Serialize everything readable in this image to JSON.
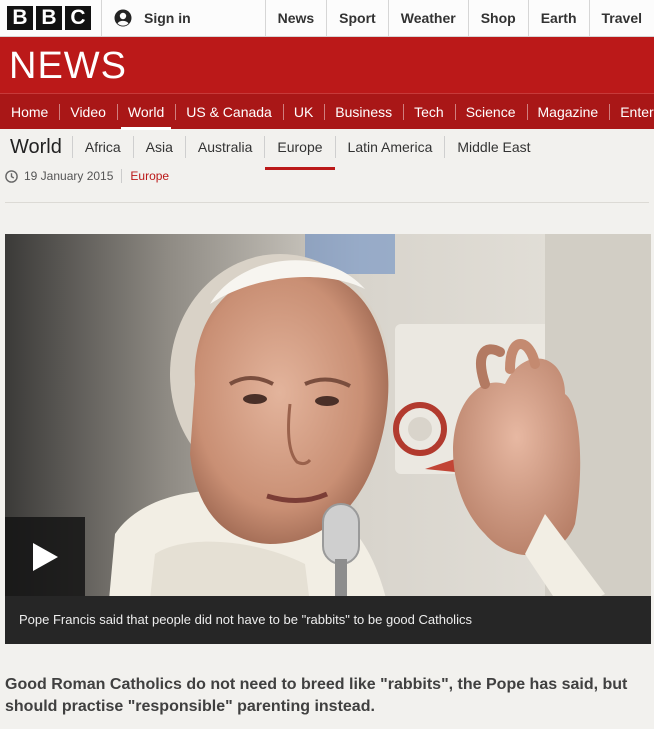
{
  "brand": {
    "logo_letters": [
      "B",
      "B",
      "C"
    ],
    "section_wordmark": "NEWS"
  },
  "account": {
    "signin_label": "Sign in",
    "icon": "user-icon"
  },
  "top_nav": [
    "News",
    "Sport",
    "Weather",
    "Shop",
    "Earth",
    "Travel"
  ],
  "main_nav": {
    "items": [
      "Home",
      "Video",
      "World",
      "US & Canada",
      "UK",
      "Business",
      "Tech",
      "Science",
      "Magazine",
      "Enter"
    ],
    "active": "World"
  },
  "sub_nav": {
    "section": "World",
    "items": [
      "Africa",
      "Asia",
      "Australia",
      "Europe",
      "Latin America",
      "Middle East"
    ],
    "active": "Europe"
  },
  "article": {
    "date": "19 January 2015",
    "tag": "Europe",
    "media_caption": "Pope Francis said that people did not have to be \"rabbits\" to be good Catholics",
    "intro": "Good Roman Catholics do not need to breed like \"rabbits\", the Pope has said, but should practise \"responsible\" parenting instead."
  },
  "colors": {
    "brand_red": "#bb1919",
    "nav_red": "#a91717",
    "caption_bg": "#262626"
  }
}
